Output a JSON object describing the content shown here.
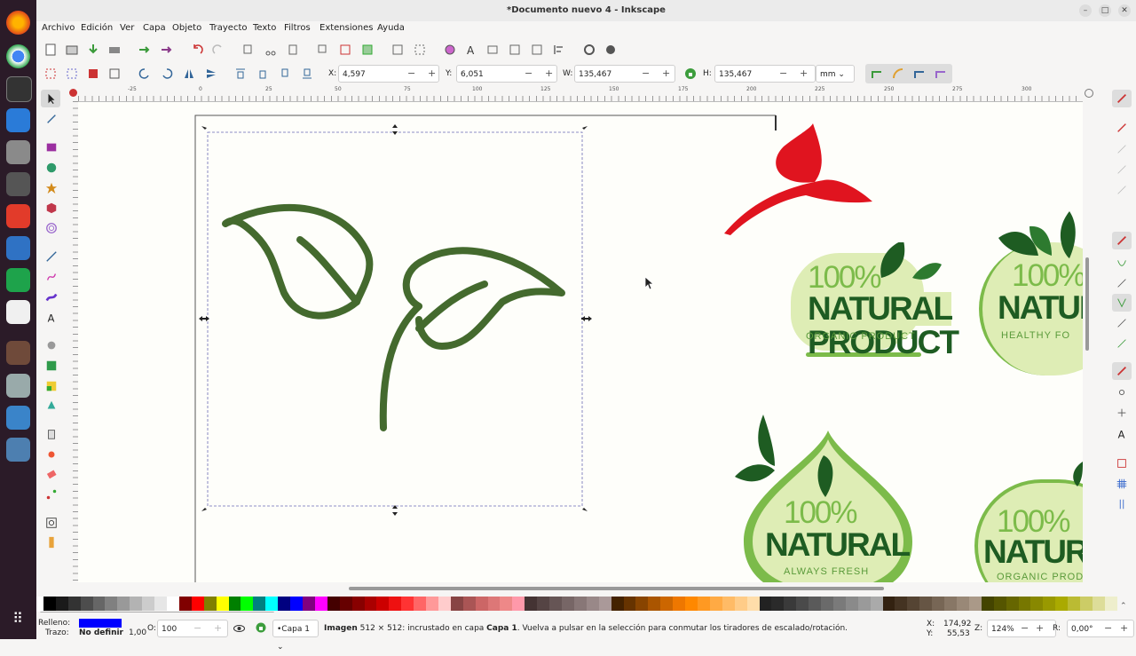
{
  "window": {
    "title": "*Documento nuevo 4 - Inkscape"
  },
  "menu": [
    "Archivo",
    "Edición",
    "Ver",
    "Capa",
    "Objeto",
    "Trayecto",
    "Texto",
    "Filtros",
    "Extensiones",
    "Ayuda"
  ],
  "controls": {
    "x_label": "X:",
    "x_value": "4,597",
    "y_label": "Y:",
    "y_value": "6,051",
    "w_label": "W:",
    "w_value": "135,467",
    "h_label": "H:",
    "h_value": "135,467",
    "unit": "mm"
  },
  "ruler": {
    "h_ticks": [
      "-25",
      "0",
      "25",
      "50",
      "75",
      "100",
      "125",
      "150",
      "175",
      "200",
      "225",
      "250",
      "275",
      "300"
    ]
  },
  "canvas": {
    "logos": [
      {
        "pct": "100%",
        "word": "NATURAL",
        "sub": "ORGANIC PRODUCT"
      },
      {
        "pct": "100%",
        "word": "NATUR",
        "sub": "HEALTHY FO"
      },
      {
        "pct": "100%",
        "word": "NATURAL",
        "sub": "ALWAYS FRESH"
      },
      {
        "pct": "100%",
        "word": "NATUR",
        "sub": "ORGANIC PROD"
      }
    ]
  },
  "status": {
    "fill_label": "Relleno:",
    "stroke_label": "Trazo:",
    "stroke_value": "No definir",
    "stroke_width": "1,00",
    "opacity_label": "O:",
    "opacity_value": "100",
    "layer": "•Capa 1",
    "message_bold": "Imagen",
    "message_1": " 512 × 512: incrustado en capa ",
    "message_layer": "Capa 1",
    "message_2": ". Vuelva a pulsar en la selección para conmutar los tiradores de escalado/rotación.",
    "x_label": "X:",
    "x_value": "174,92",
    "y_label": "Y:",
    "y_value": "55,53",
    "zoom_label": "Z:",
    "zoom_value": "124%",
    "rot_label": "R:",
    "rot_value": "0,00°"
  },
  "colors": {
    "leaf_green": "#446a2e",
    "red_leaf": "#e0141f",
    "logo_dark": "#1e5c22",
    "logo_light": "#7cbb4a",
    "logo_bg": "#deedb5",
    "fill_swatch": "#0000ff",
    "accent": "#3c9d3c"
  }
}
